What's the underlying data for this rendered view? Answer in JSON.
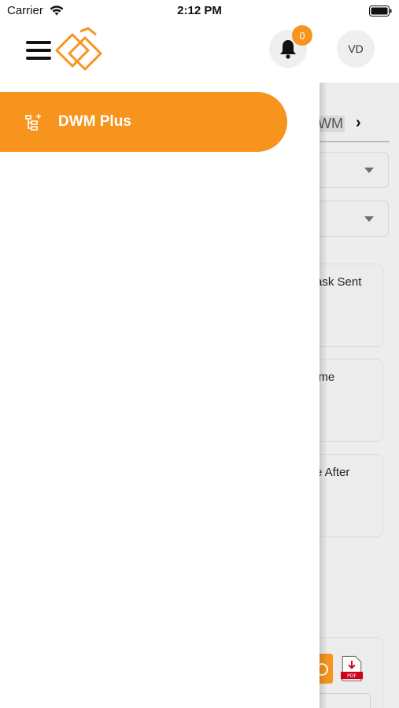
{
  "status_bar": {
    "carrier": "Carrier",
    "time": "2:12 PM"
  },
  "header": {
    "notification_count": "0",
    "avatar_initials": "VD"
  },
  "drawer": {
    "items": [
      {
        "label": "DWM Plus",
        "icon": "hierarchy-add-icon"
      }
    ]
  },
  "background": {
    "tab_label": "WM",
    "cards": [
      {
        "label": "ask Sent"
      },
      {
        "label": "ime"
      },
      {
        "label": "e After"
      }
    ],
    "pdf_icon_text": "PDF"
  },
  "colors": {
    "accent": "#f7941d",
    "overlay": "#ededed"
  }
}
